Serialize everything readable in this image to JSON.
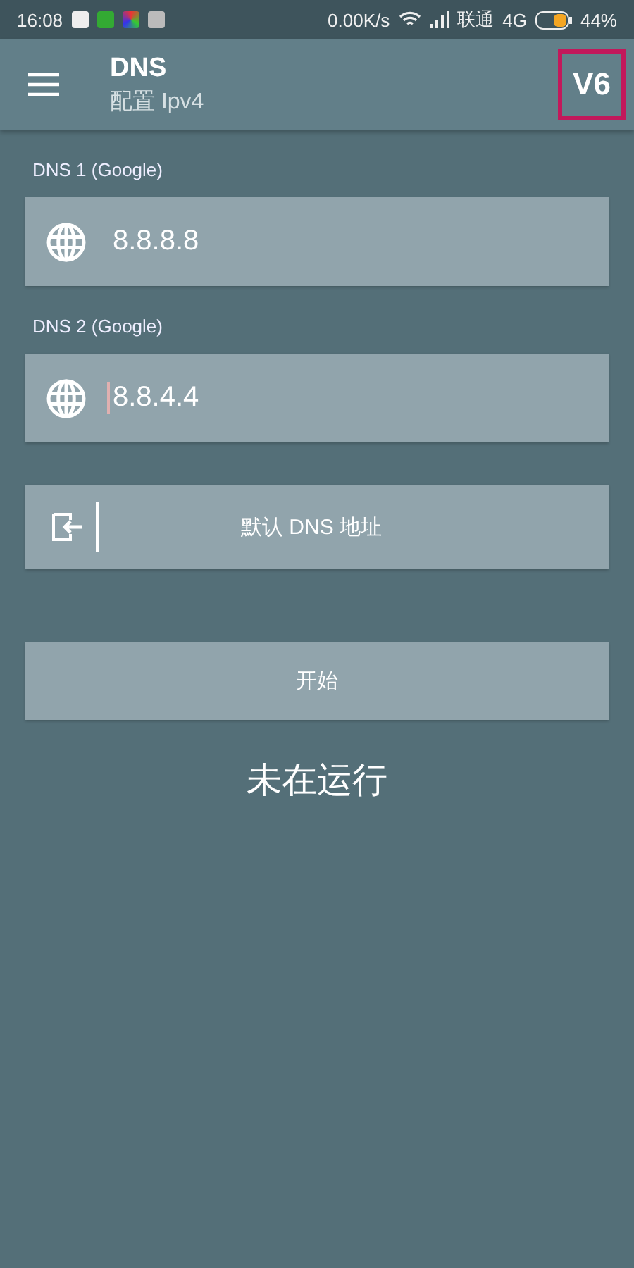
{
  "status_bar": {
    "time": "16:08",
    "speed": "0.00K/s",
    "carrier": "联通",
    "network": "4G",
    "battery": "44%"
  },
  "app_bar": {
    "title": "DNS",
    "subtitle": "配置 Ipv4",
    "action": {
      "label": "V6",
      "highlighted": true
    }
  },
  "fields": [
    {
      "label": "DNS 1 (Google)",
      "value": "8.8.8.8",
      "focused": false
    },
    {
      "label": "DNS 2 (Google)",
      "value": "8.8.4.4",
      "focused": true
    }
  ],
  "default_button": {
    "label": "默认 DNS 地址"
  },
  "start_button": {
    "label": "开始"
  },
  "status_text": "未在运行"
}
